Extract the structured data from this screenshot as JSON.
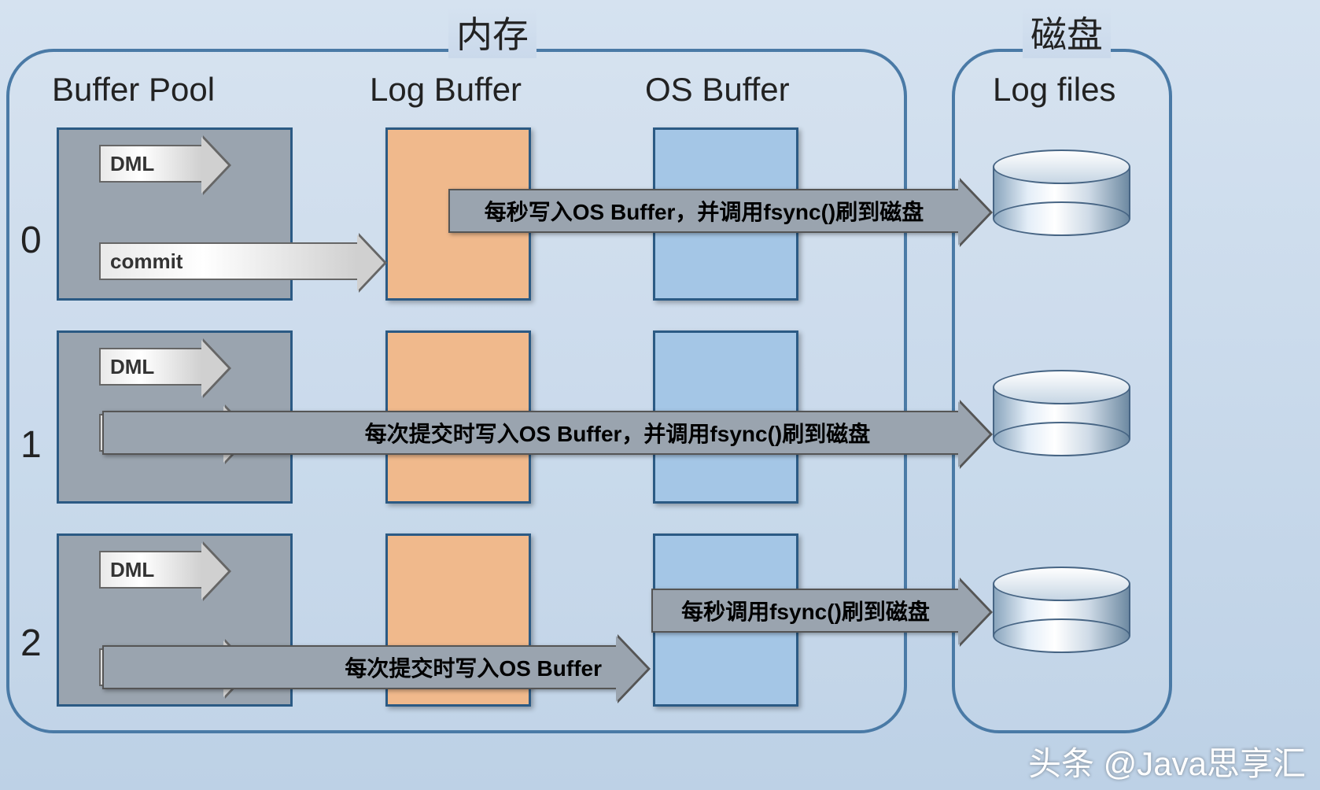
{
  "titles": {
    "memory": "内存",
    "disk": "磁盘"
  },
  "columns": {
    "buffer_pool": "Buffer Pool",
    "log_buffer": "Log Buffer",
    "os_buffer": "OS Buffer",
    "log_files": "Log files"
  },
  "modes": {
    "m0": "0",
    "m1": "1",
    "m2": "2"
  },
  "labels": {
    "dml": "DML",
    "commit": "commit"
  },
  "arrows": {
    "row0": "每秒写入OS Buffer，并调用fsync()刷到磁盘",
    "row1": "每次提交时写入OS Buffer，并调用fsync()刷到磁盘",
    "row2_commit": "每次提交时写入OS Buffer",
    "row2_fsync": "每秒调用fsync()刷到磁盘"
  },
  "watermark": "头条 @Java思享汇"
}
